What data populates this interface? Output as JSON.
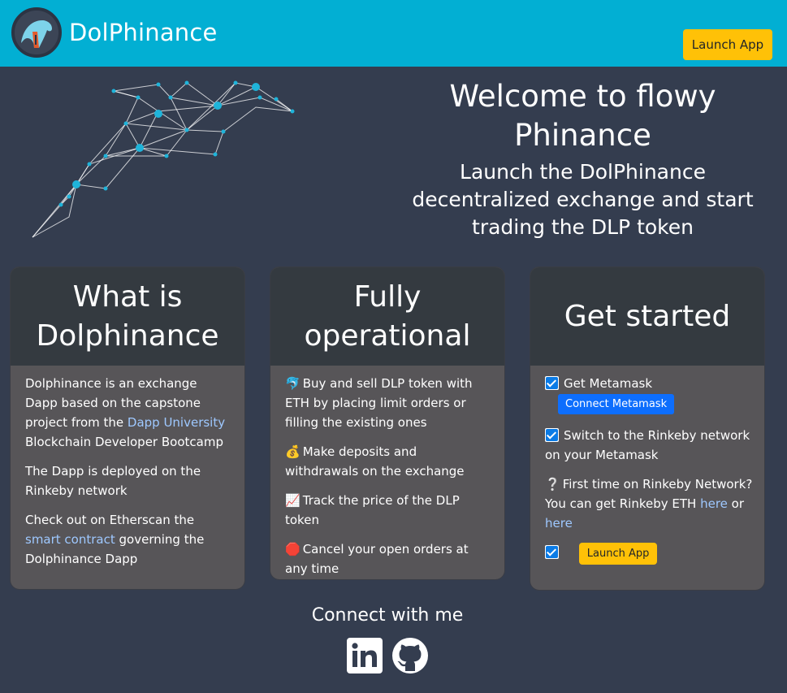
{
  "navbar": {
    "brand": "DolPhinance",
    "launch_label": "Launch App",
    "bg_color": "#02afd3"
  },
  "hero": {
    "title": "Welcome to flowy Phinance",
    "subtitle": "Launch the DolPhinance decentralized exchange and start trading the DLP token"
  },
  "cards": {
    "what": {
      "title": "What is Dolphinance",
      "p1_a": "Dolphinance is an exchange Dapp based on the capstone project from the ",
      "p1_link": "Dapp University",
      "p1_b": " Blockchain Developer Bootcamp",
      "p2": "The Dapp is deployed on the Rinkeby network",
      "p3_a": "Check out on Etherscan the ",
      "p3_link": "smart contract",
      "p3_b": " governing the Dolphinance Dapp"
    },
    "operational": {
      "title": "Fully operational",
      "items": [
        {
          "icon": "🐬",
          "text": "Buy and sell DLP token with ETH by placing limit orders or filling the existing ones"
        },
        {
          "icon": "💰",
          "text": "Make deposits and withdrawals on the exchange"
        },
        {
          "icon": "📈",
          "text": "Track the price of the DLP token"
        },
        {
          "icon": "🛑",
          "text": "Cancel your open orders at any time"
        }
      ]
    },
    "started": {
      "title": "Get started",
      "step1": "Get Metamask",
      "connect_label": "Connect Metamask",
      "step2": "Switch to the Rinkeby network on your Metamask",
      "question_icon": "❔",
      "step3_a": "First time on Rinkeby Network? You can get Rinkeby ETH ",
      "here1": "here",
      "or": " or ",
      "here2": "here",
      "launch_label": "Launch App"
    }
  },
  "footer": {
    "title": "Connect with me",
    "icons": [
      "linkedin-icon",
      "github-icon"
    ]
  }
}
